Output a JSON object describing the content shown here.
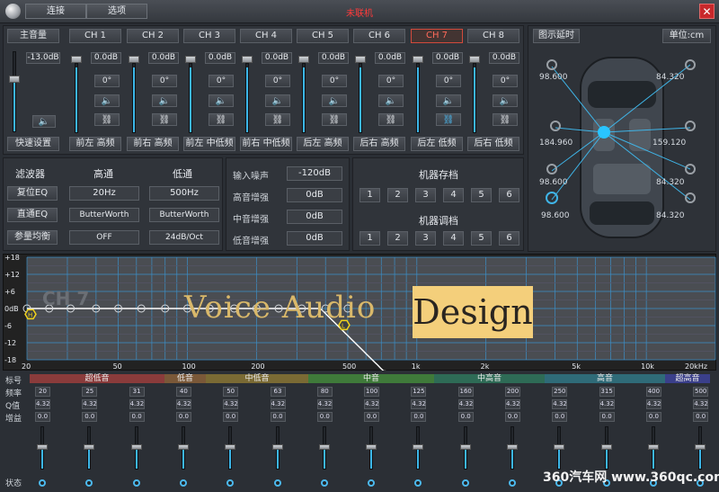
{
  "window": {
    "title": "未联机",
    "menu": [
      "连接",
      "选项"
    ],
    "close": "✕"
  },
  "channels": {
    "master_label": "主音量",
    "master_value": "-13.0dB",
    "quick_setup": "快速设置",
    "items": [
      {
        "name": "CH 1",
        "gain": "0.0dB",
        "phase": "0°",
        "output": "前左 高频"
      },
      {
        "name": "CH 2",
        "gain": "0.0dB",
        "phase": "0°",
        "output": "前右 高频"
      },
      {
        "name": "CH 3",
        "gain": "0.0dB",
        "phase": "0°",
        "output": "前左 中低频"
      },
      {
        "name": "CH 4",
        "gain": "0.0dB",
        "phase": "0°",
        "output": "前右 中低频"
      },
      {
        "name": "CH 5",
        "gain": "0.0dB",
        "phase": "0°",
        "output": "后左 高频"
      },
      {
        "name": "CH 6",
        "gain": "0.0dB",
        "phase": "0°",
        "output": "后右 高频"
      },
      {
        "name": "CH 7",
        "gain": "0.0dB",
        "phase": "0°",
        "output": "后左 低频"
      },
      {
        "name": "CH 8",
        "gain": "0.0dB",
        "phase": "0°",
        "output": "后右 低频"
      }
    ],
    "active_index": 6
  },
  "delay": {
    "label": "图示延时",
    "unit": "单位:cm",
    "values": [
      "98.600",
      "84.320",
      "184.960",
      "159.120",
      "98.600",
      "84.320",
      "98.600",
      "84.320"
    ]
  },
  "filter": {
    "title": "滤波器",
    "hp_label": "高通",
    "lp_label": "低通",
    "buttons": [
      "复位EQ",
      "直通EQ",
      "参量均衡"
    ],
    "hp": {
      "freq": "20Hz",
      "type": "ButterWorth",
      "slope": "OFF"
    },
    "lp": {
      "freq": "500Hz",
      "type": "ButterWorth",
      "slope": "24dB/Oct"
    }
  },
  "input": {
    "labels": [
      "输入噪声",
      "高音增强",
      "中音增强",
      "低音增强"
    ],
    "values": [
      "-120dB",
      "0dB",
      "0dB",
      "0dB"
    ]
  },
  "machine": {
    "store_label": "机器存档",
    "recall_label": "机器调档",
    "slots": [
      "1",
      "2",
      "3",
      "4",
      "5",
      "6"
    ]
  },
  "plot": {
    "y_labels": [
      "+18",
      "+12",
      "+6",
      "0dB",
      "-6",
      "-12",
      "-18"
    ],
    "x_labels": [
      "20",
      "50",
      "100",
      "200",
      "500",
      "1k",
      "2k",
      "5k",
      "10k",
      "20kHz"
    ],
    "channel_label": "CH 7",
    "watermark_a": "Voice Audio",
    "watermark_b": "Design",
    "marker_h": "H",
    "marker_l": "L"
  },
  "eq": {
    "row_labels": [
      "标号",
      "频率",
      "Q值",
      "增益"
    ],
    "status_label": "状态",
    "bands": [
      {
        "name": "超低音",
        "color": "#8a3b3b"
      },
      {
        "name": "低音",
        "color": "#7a5838"
      },
      {
        "name": "中低音",
        "color": "#7a6a34"
      },
      {
        "name": "中音",
        "color": "#3f7a3a"
      },
      {
        "name": "中高音",
        "color": "#2e6b56"
      },
      {
        "name": "高音",
        "color": "#2f6b78"
      },
      {
        "name": "超高音",
        "color": "#3a3f8a"
      }
    ],
    "freqs": [
      "20",
      "25",
      "31",
      "40",
      "50",
      "63",
      "80",
      "100",
      "125",
      "160",
      "200",
      "250",
      "315",
      "400",
      "500"
    ],
    "q": "4.32",
    "gain": "0.0"
  },
  "footer": {
    "watermark": "360汽车网 www.360qc.com"
  }
}
